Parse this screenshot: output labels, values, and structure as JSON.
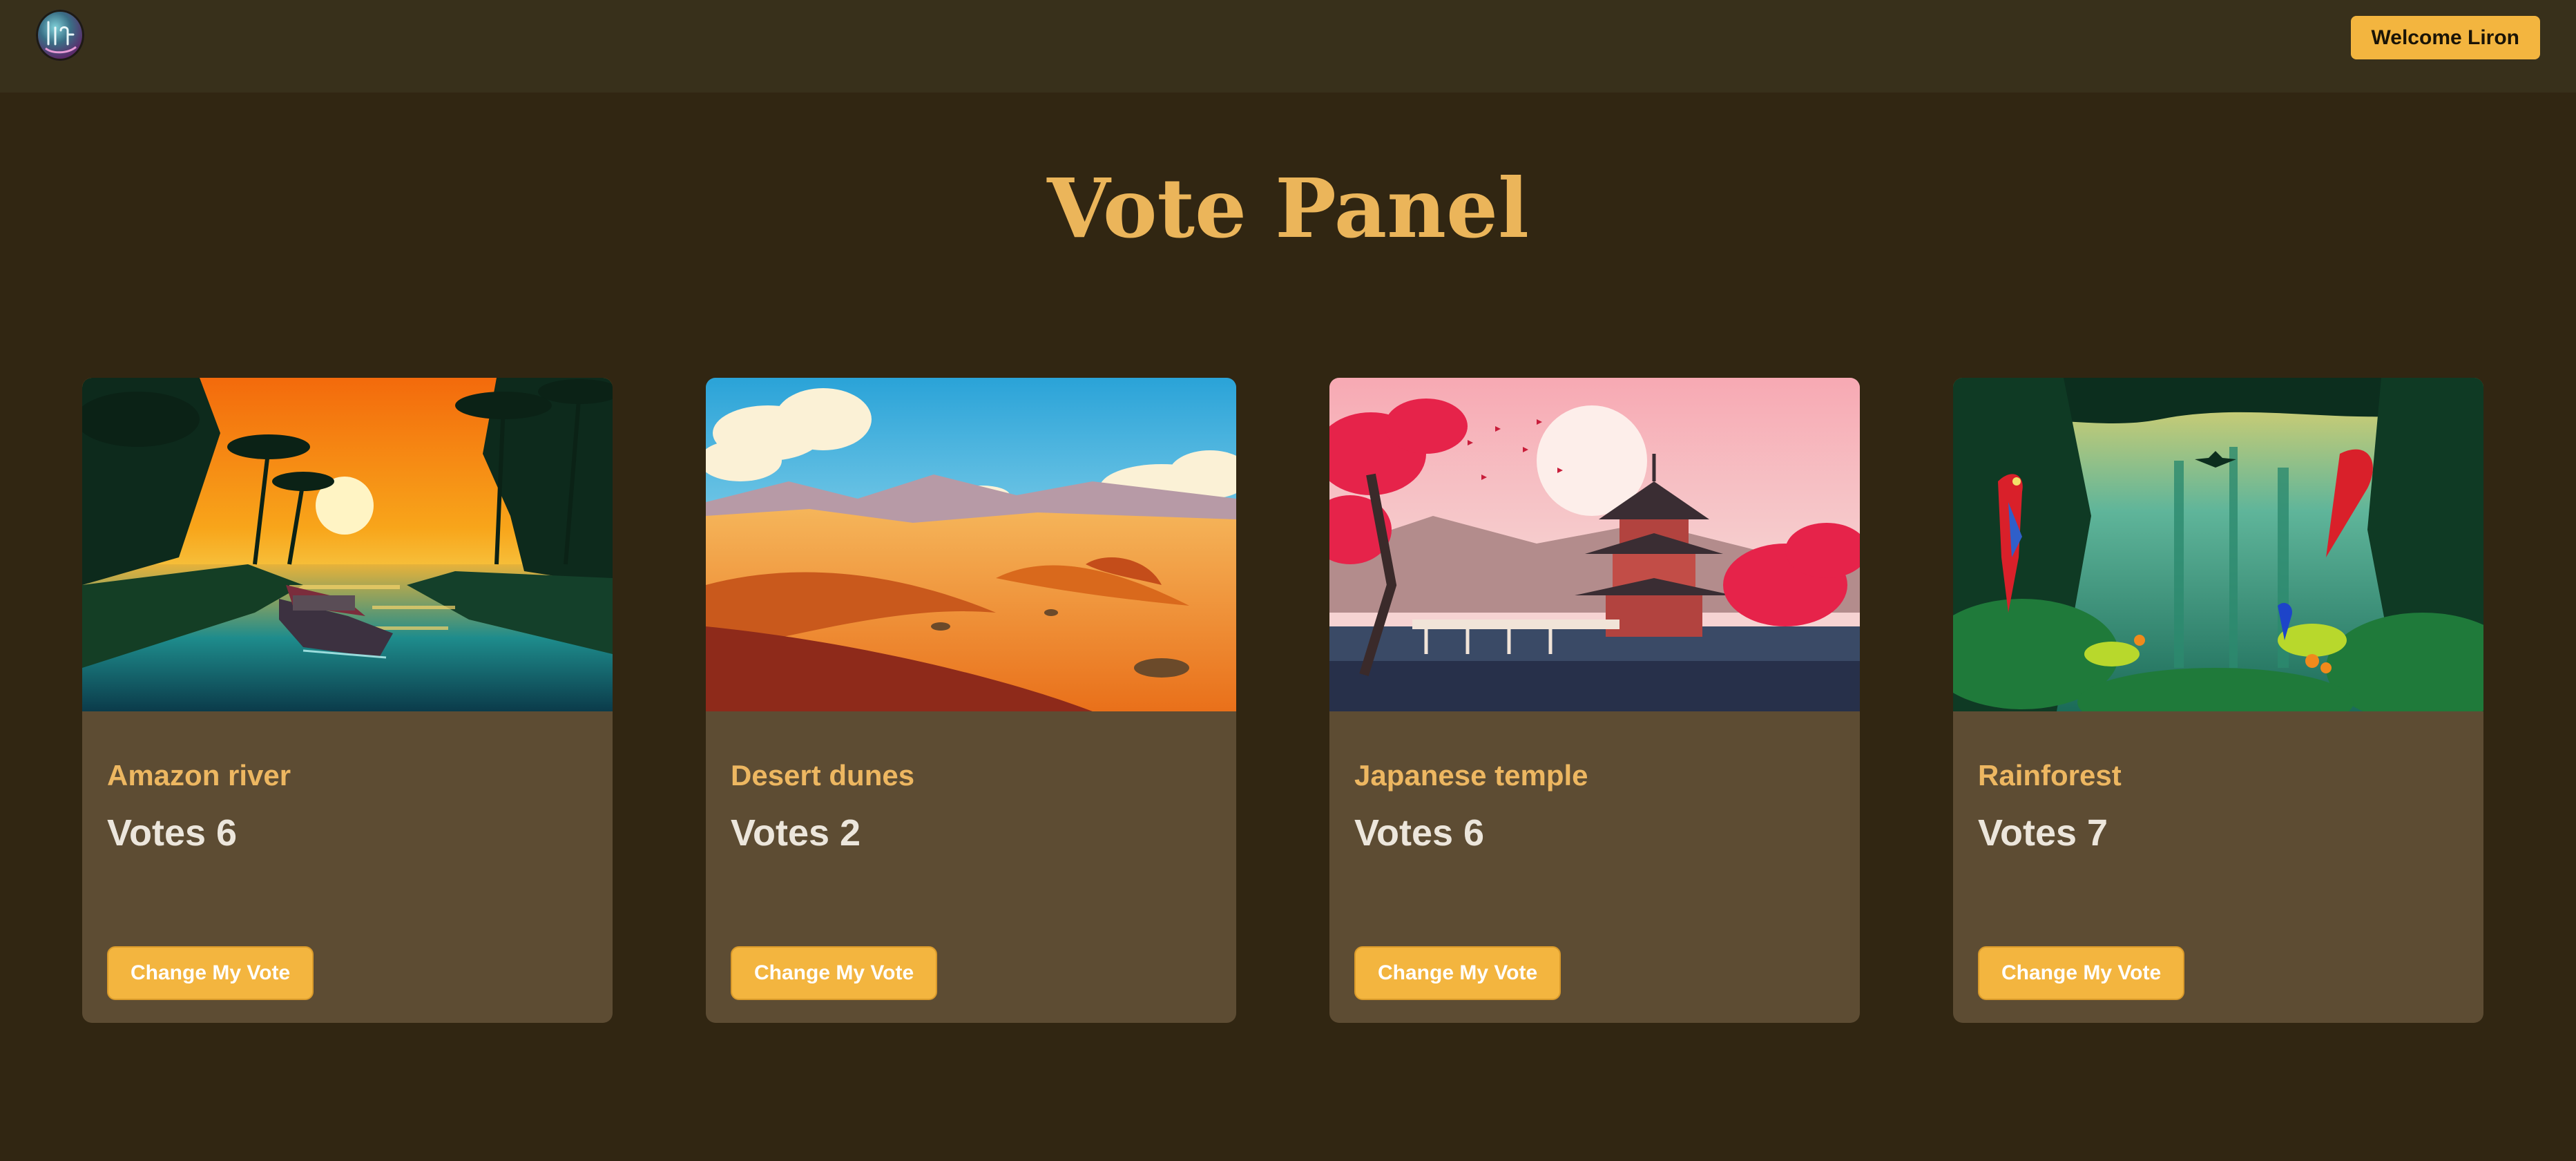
{
  "header": {
    "logo_text": "Liron",
    "welcome_label": "Welcome Liron"
  },
  "main": {
    "title": "Vote Panel",
    "cards": [
      {
        "title": "Amazon river",
        "votes_text": "Votes 6",
        "votes": 6,
        "button_label": "Change My Vote",
        "image": "river-jungle-sunset-illustration"
      },
      {
        "title": "Desert dunes",
        "votes_text": "Votes 2",
        "votes": 2,
        "button_label": "Change My Vote",
        "image": "desert-dunes-illustration"
      },
      {
        "title": "Japanese temple",
        "votes_text": "Votes 6",
        "votes": 6,
        "button_label": "Change My Vote",
        "image": "japanese-pagoda-illustration"
      },
      {
        "title": "Rainforest",
        "votes_text": "Votes 7",
        "votes": 7,
        "button_label": "Change My Vote",
        "image": "rainforest-parrots-illustration"
      }
    ]
  },
  "colors": {
    "background": "#312612",
    "header": "#38301b",
    "card": "#5d4c33",
    "accent": "#f3b53f",
    "title": "#ebb55a"
  }
}
